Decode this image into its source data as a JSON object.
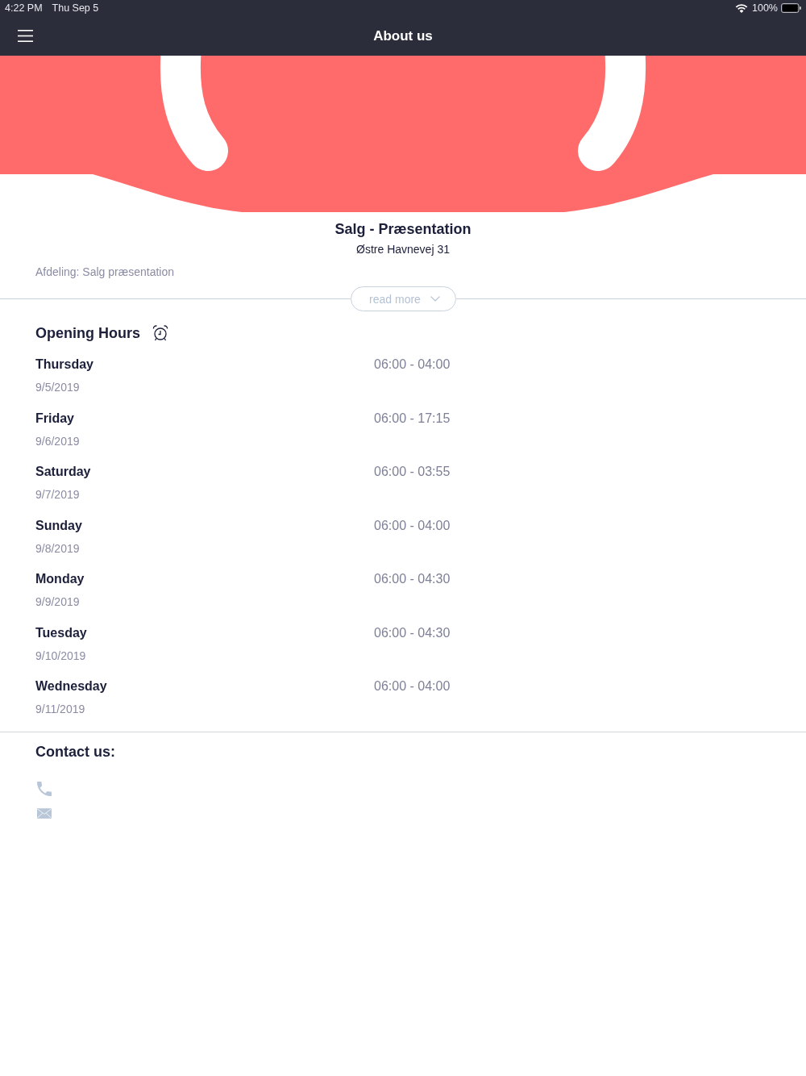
{
  "status_bar": {
    "time": "4:22 PM",
    "date": "Thu Sep 5",
    "battery": "100%"
  },
  "nav_bar": {
    "title": "About us"
  },
  "department": {
    "name": "Salg - Præsentation",
    "address": "Østre Havnevej 31",
    "description": "Afdeling: Salg præsentation",
    "read_more": {
      "label": "read more",
      "expanded": false
    }
  },
  "opening_hours": {
    "title": "Opening Hours",
    "days": [
      {
        "day": "Thursday",
        "date": "9/5/2019",
        "hours": "06:00 - 04:00"
      },
      {
        "day": "Friday",
        "date": "9/6/2019",
        "hours": "06:00 - 17:15"
      },
      {
        "day": "Saturday",
        "date": "9/7/2019",
        "hours": "06:00 - 03:55"
      },
      {
        "day": "Sunday",
        "date": "9/8/2019",
        "hours": "06:00 - 04:00"
      },
      {
        "day": "Monday",
        "date": "9/9/2019",
        "hours": "06:00 - 04:30"
      },
      {
        "day": "Tuesday",
        "date": "9/10/2019",
        "hours": "06:00 - 04:30"
      },
      {
        "day": "Wednesday",
        "date": "9/11/2019",
        "hours": "06:00 - 04:00"
      }
    ]
  },
  "contact": {
    "title": "Contact us:",
    "items": [
      {
        "kind": "phone"
      },
      {
        "kind": "email"
      }
    ]
  }
}
